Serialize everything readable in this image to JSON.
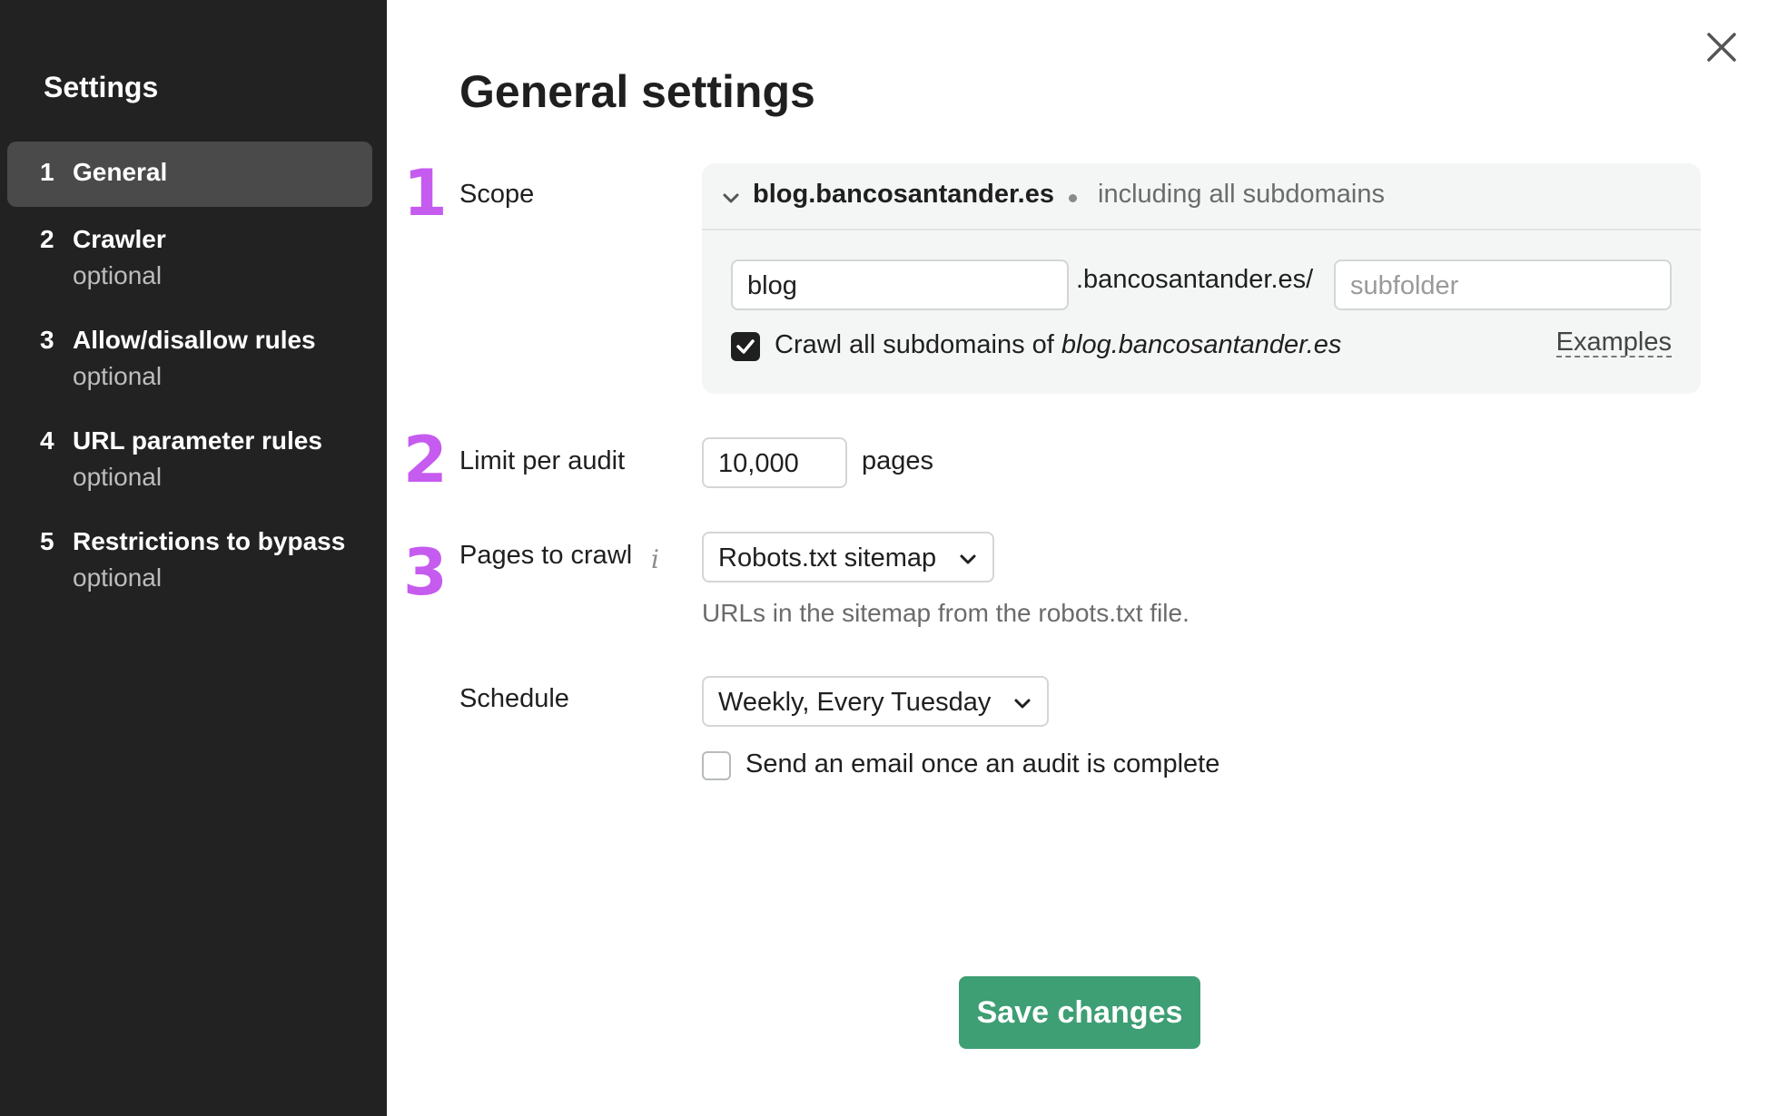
{
  "sidebar": {
    "title": "Settings",
    "items": [
      {
        "num": "1",
        "label": "General",
        "sub": ""
      },
      {
        "num": "2",
        "label": "Crawler",
        "sub": "optional"
      },
      {
        "num": "3",
        "label": "Allow/disallow rules",
        "sub": "optional"
      },
      {
        "num": "4",
        "label": "URL parameter rules",
        "sub": "optional"
      },
      {
        "num": "5",
        "label": "Restrictions to bypass",
        "sub": "optional"
      }
    ]
  },
  "main": {
    "title": "General settings",
    "scope": {
      "step": "1",
      "label": "Scope",
      "domain": "blog.bancosantander.es",
      "subdomains_note": "including all subdomains",
      "subdomain_value": "blog",
      "domain_middle": ".bancosantander.es/",
      "subfolder_placeholder": "subfolder",
      "crawl_all_prefix": "Crawl all subdomains of ",
      "crawl_all_domain": "blog.bancosantander.es",
      "crawl_all_checked": true,
      "examples_link": "Examples"
    },
    "limit": {
      "step": "2",
      "label": "Limit per audit",
      "value": "10,000",
      "unit": "pages"
    },
    "pages_to_crawl": {
      "step": "3",
      "label": "Pages to crawl",
      "info_glyph": "i",
      "selected": "Robots.txt sitemap",
      "hint": "URLs in the sitemap from the robots.txt file."
    },
    "schedule": {
      "label": "Schedule",
      "selected": "Weekly, Every Tuesday",
      "email_label": "Send an email once an audit is complete",
      "email_checked": false
    },
    "save_label": "Save changes"
  },
  "colors": {
    "sidebar_bg": "#222222",
    "active_item_bg": "#4a4a4a",
    "step_number": "#c65bf0",
    "save_button": "#3e9e74"
  }
}
